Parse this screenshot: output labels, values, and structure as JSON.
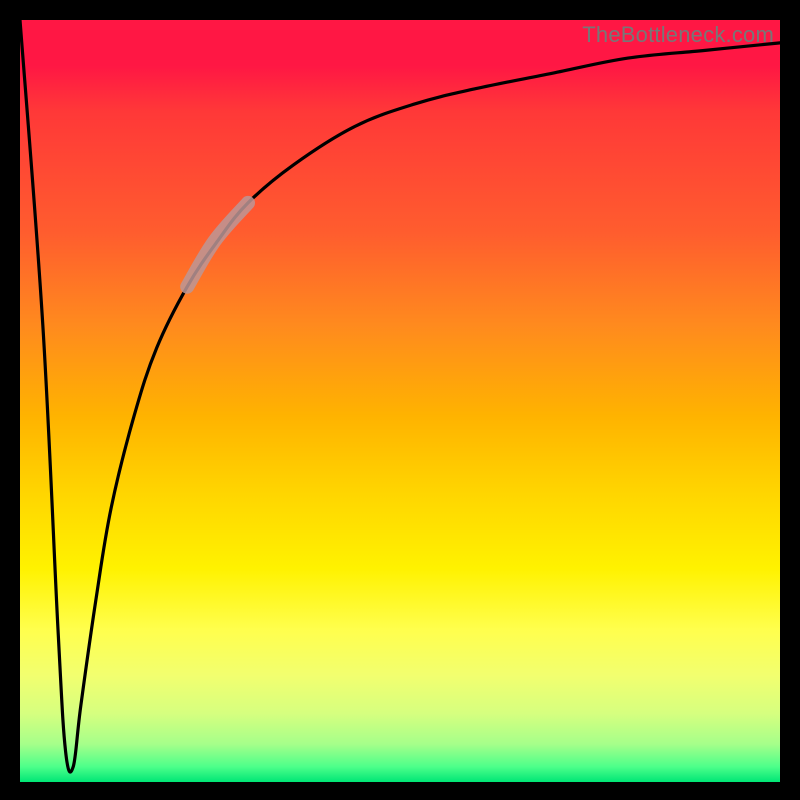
{
  "watermark": "TheBottleneck.com",
  "chart_data": {
    "type": "line",
    "title": "",
    "xlabel": "",
    "ylabel": "",
    "xlim": [
      0,
      100
    ],
    "ylim": [
      0,
      100
    ],
    "grid": false,
    "legend": false,
    "background": "red-yellow-green vertical gradient",
    "x": [
      0,
      3,
      5,
      6,
      7,
      8,
      10,
      12,
      15,
      18,
      22,
      26,
      30,
      36,
      44,
      52,
      60,
      70,
      80,
      90,
      100
    ],
    "y": [
      100,
      60,
      20,
      4,
      2,
      10,
      24,
      36,
      48,
      57,
      65,
      71,
      76,
      81,
      86,
      89,
      91,
      93,
      95,
      96,
      97
    ],
    "highlight_segment": {
      "x_start": 22,
      "x_end": 30,
      "y_start": 65,
      "y_end": 76
    }
  },
  "frame": {
    "border_color": "#000000",
    "border_px": 20
  },
  "note": "No axis ticks or labels are shown; curve values are estimated from the plotted shape."
}
